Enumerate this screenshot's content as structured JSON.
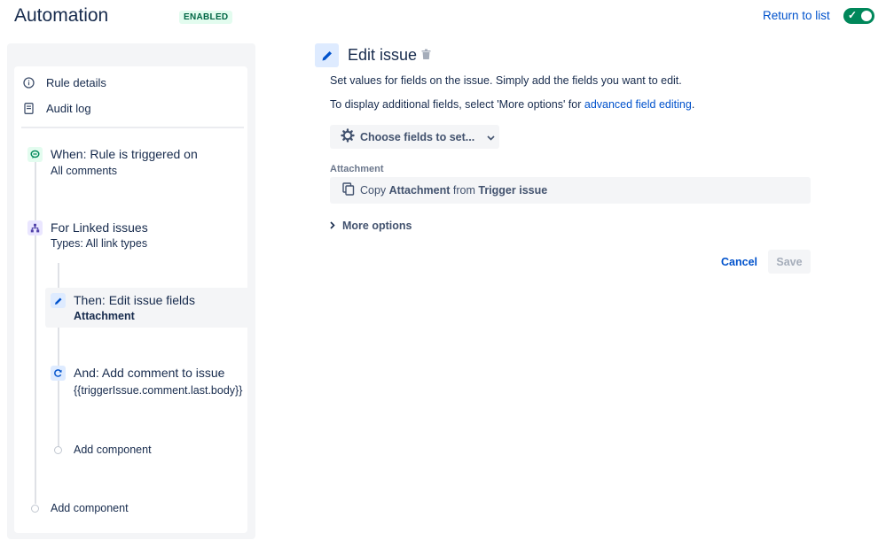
{
  "header": {
    "title": "Automation",
    "status": "ENABLED",
    "return_link": "Return to list",
    "toggle_on": true
  },
  "sidebar": {
    "nav": [
      {
        "label": "Rule details",
        "icon": "info-icon"
      },
      {
        "label": "Audit log",
        "icon": "document-icon"
      }
    ],
    "steps": {
      "trigger": {
        "title": "When: Rule is triggered on",
        "subtitle": "All comments",
        "icon": "comment-trigger-icon"
      },
      "branch": {
        "title": "For Linked issues",
        "subtitle": "Types: All link types",
        "icon": "branch-icon"
      },
      "action1": {
        "title": "Then: Edit issue fields",
        "subtitle": "Attachment",
        "icon": "pencil-icon",
        "selected": true
      },
      "action2": {
        "title": "And: Add comment to issue",
        "subtitle": "{{triggerIssue.comment.last.body}}",
        "icon": "refresh-icon"
      }
    },
    "add_component_inner": "Add component",
    "add_component_outer": "Add component"
  },
  "editor": {
    "title": "Edit issue",
    "description1": "Set values for fields on the issue. Simply add the fields you want to edit.",
    "description2_prefix": "To display additional fields, select 'More options' for ",
    "description2_link": "advanced field editing",
    "description2_suffix": ".",
    "choose_fields_label": "Choose fields to set...",
    "field_label": "Attachment",
    "field_value": {
      "prefix": "Copy ",
      "field": "Attachment",
      "middle": " from ",
      "source": "Trigger issue"
    },
    "more_options": "More options",
    "cancel": "Cancel",
    "save": "Save"
  },
  "colors": {
    "accent": "#0052cc",
    "enabled_green": "#00875a",
    "lozenge_bg": "#e3fcef",
    "lozenge_text": "#006644"
  }
}
